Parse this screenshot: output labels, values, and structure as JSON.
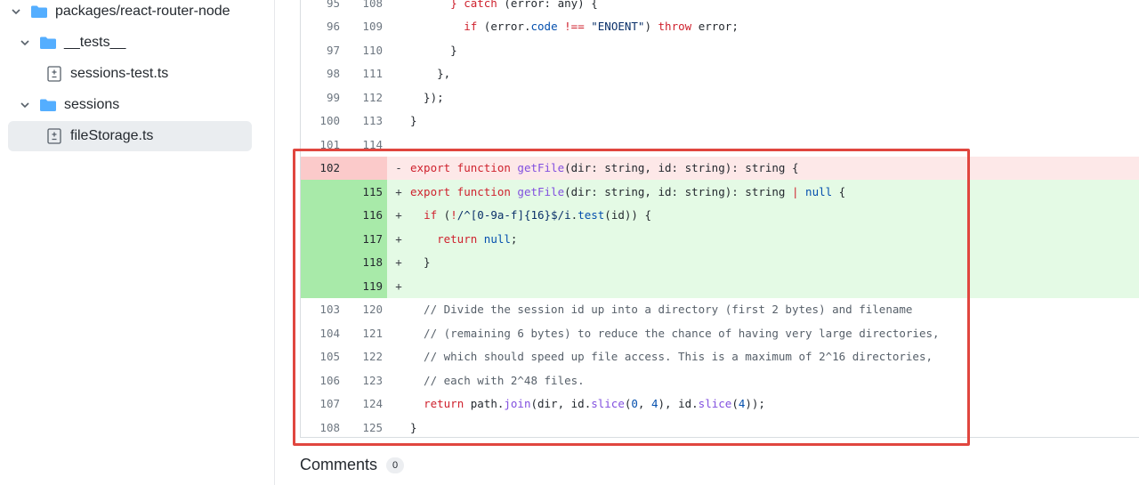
{
  "sidebar": {
    "items": [
      {
        "label": "packages/react-router-node",
        "type": "folder"
      },
      {
        "label": "__tests__",
        "type": "folder"
      },
      {
        "label": "sessions-test.ts",
        "type": "file"
      },
      {
        "label": "sessions",
        "type": "folder"
      },
      {
        "label": "fileStorage.ts",
        "type": "file"
      }
    ]
  },
  "diff": {
    "lines": [
      {
        "old": "95",
        "new": "108",
        "sign": "",
        "kind": "ctx"
      },
      {
        "old": "96",
        "new": "109",
        "sign": "",
        "kind": "ctx"
      },
      {
        "old": "97",
        "new": "110",
        "sign": "",
        "kind": "ctx"
      },
      {
        "old": "98",
        "new": "111",
        "sign": "",
        "kind": "ctx"
      },
      {
        "old": "99",
        "new": "112",
        "sign": "",
        "kind": "ctx"
      },
      {
        "old": "100",
        "new": "113",
        "sign": "",
        "kind": "ctx"
      },
      {
        "old": "101",
        "new": "114",
        "sign": "",
        "kind": "ctx"
      },
      {
        "old": "102",
        "new": "",
        "sign": "-",
        "kind": "del"
      },
      {
        "old": "",
        "new": "115",
        "sign": "+",
        "kind": "add"
      },
      {
        "old": "",
        "new": "116",
        "sign": "+",
        "kind": "add"
      },
      {
        "old": "",
        "new": "117",
        "sign": "+",
        "kind": "add"
      },
      {
        "old": "",
        "new": "118",
        "sign": "+",
        "kind": "add"
      },
      {
        "old": "",
        "new": "119",
        "sign": "+",
        "kind": "add"
      },
      {
        "old": "103",
        "new": "120",
        "sign": "",
        "kind": "ctx"
      },
      {
        "old": "104",
        "new": "121",
        "sign": "",
        "kind": "ctx"
      },
      {
        "old": "105",
        "new": "122",
        "sign": "",
        "kind": "ctx"
      },
      {
        "old": "106",
        "new": "123",
        "sign": "",
        "kind": "ctx"
      },
      {
        "old": "107",
        "new": "124",
        "sign": "",
        "kind": "ctx"
      },
      {
        "old": "108",
        "new": "125",
        "sign": "",
        "kind": "ctx"
      }
    ],
    "code": {
      "l95": "      } catch (error: any) {",
      "l96": "        if (error.code !== \"ENOENT\") throw error;",
      "l97": "      }",
      "l98": "    },",
      "l99": "  });",
      "l100": "}",
      "l101": "",
      "l102": "export function getFile(dir: string, id: string): string {",
      "l115": "export function getFile(dir: string, id: string): string | null {",
      "l116": "  if (!/^[0-9a-f]{16}$/i.test(id)) {",
      "l117": "    return null;",
      "l118": "  }",
      "l119": "",
      "l120": "  // Divide the session id up into a directory (first 2 bytes) and filename",
      "l121": "  // (remaining 6 bytes) to reduce the chance of having very large directories,",
      "l122": "  // which should speed up file access. This is a maximum of 2^16 directories,",
      "l123": "  // each with 2^48 files.",
      "l124": "  return path.join(dir, id.slice(0, 4), id.slice(4));",
      "l125": "}"
    }
  },
  "comments": {
    "title": "Comments",
    "count": "0"
  },
  "colors": {
    "highlight_border": "#e0463f",
    "added_bg": "#e4fae5",
    "removed_bg": "#fde8e8",
    "folder_blue": "#54aeff"
  }
}
